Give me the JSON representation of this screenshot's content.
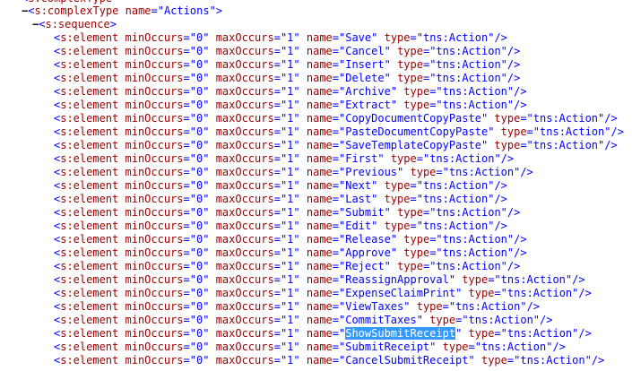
{
  "document": {
    "partial_top_text": "<s:complexType",
    "complex_type": {
      "collapse_glyph": "−",
      "tag": "s:complexType",
      "attr_name": "name",
      "attr_value": "Actions"
    },
    "sequence": {
      "collapse_glyph": "−",
      "tag": "s:sequence"
    },
    "element_tag": "s:element",
    "attr_names": [
      "minOccurs",
      "maxOccurs",
      "name",
      "type"
    ],
    "min_occurs": "0",
    "max_occurs": "1",
    "type_value": "tns:Action",
    "elements": [
      {
        "name": "Save"
      },
      {
        "name": "Cancel"
      },
      {
        "name": "Insert"
      },
      {
        "name": "Delete"
      },
      {
        "name": "Archive"
      },
      {
        "name": "Extract"
      },
      {
        "name": "CopyDocumentCopyPaste"
      },
      {
        "name": "PasteDocumentCopyPaste"
      },
      {
        "name": "SaveTemplateCopyPaste"
      },
      {
        "name": "First"
      },
      {
        "name": "Previous"
      },
      {
        "name": "Next"
      },
      {
        "name": "Last"
      },
      {
        "name": "Submit"
      },
      {
        "name": "Edit"
      },
      {
        "name": "Release"
      },
      {
        "name": "Approve"
      },
      {
        "name": "Reject"
      },
      {
        "name": "ReassignApproval"
      },
      {
        "name": "ExpenseClaimPrint"
      },
      {
        "name": "ViewTaxes"
      },
      {
        "name": "CommitTaxes"
      },
      {
        "name": "ShowSubmitReceipt",
        "selected": true
      },
      {
        "name": "SubmitReceipt"
      },
      {
        "name": "CancelSubmitReceipt"
      }
    ],
    "colors": {
      "tag": "#990000",
      "punctuation": "#0000ff",
      "attribute_value": "#0000ff",
      "selection": "#3399ff"
    }
  }
}
